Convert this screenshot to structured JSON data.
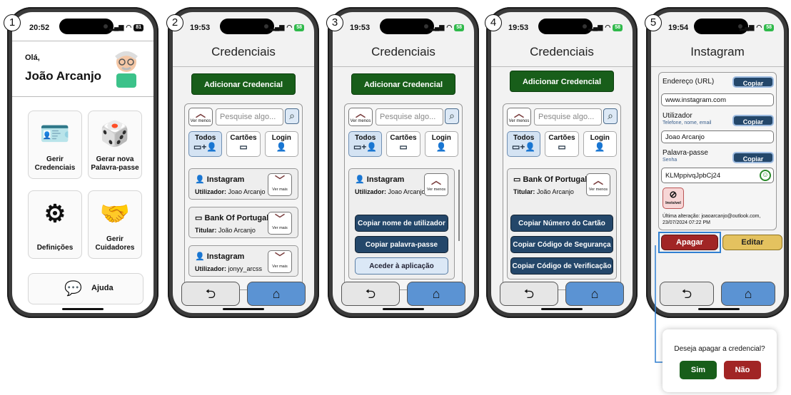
{
  "steps": [
    "1",
    "2",
    "3",
    "4",
    "5"
  ],
  "p1": {
    "time": "20:52",
    "battery": "81",
    "greeting": "Olá,",
    "name": "João Arcanjo",
    "tiles": [
      "Gerir Credenciais",
      "Gerar nova Palavra-passe",
      "Definições",
      "Gerir Cuidadores"
    ],
    "help": "Ajuda"
  },
  "p2": {
    "time": "19:53",
    "battery": "58",
    "title": "Credenciais",
    "add": "Adicionar Credencial",
    "ver_menos": "Ver menos",
    "search_placeholder": "Pesquise algo...",
    "tabs": [
      "Todos",
      "Cartões",
      "Login"
    ],
    "ver_mais": "Ver mais",
    "cards": [
      {
        "name": "Instagram",
        "label": "Utilizador:",
        "value": "Joao Arcanjo"
      },
      {
        "name": "Bank Of Portugal",
        "label": "Titular:",
        "value": "João Arcanjo"
      },
      {
        "name": "Instagram",
        "label": "Utilizador:",
        "value": "jonyy_arcss"
      }
    ]
  },
  "p3": {
    "time": "19:53",
    "battery": "58",
    "card_name": "Instagram",
    "card_label": "Utilizador:",
    "card_value": "Joao Arcanjo",
    "ver_menos": "Ver menos",
    "actions": [
      "Copiar nome de utilizador",
      "Copiar palavra-passe",
      "Aceder à aplicação"
    ]
  },
  "p4": {
    "time": "19:53",
    "battery": "58",
    "card_name": "Bank Of Portugal",
    "card_label": "Titular:",
    "card_value": "João Arcanjo",
    "ver_menos": "Ver menos",
    "actions": [
      "Copiar Número do Cartão",
      "Copiar Código de Segurança",
      "Copiar Código de Verificação"
    ]
  },
  "p5": {
    "time": "19:54",
    "battery": "58",
    "title": "Instagram",
    "url_label": "Endereço (URL)",
    "url_value": "www.instagram.com",
    "user_label": "Utilizador",
    "user_sub": "Telefone, nome, email",
    "user_value": "Joao Arcanjo",
    "pass_label": "Palavra-passe",
    "pass_sub": "Senha",
    "pass_value": "KLMppivqJpbCj24",
    "copy": "Copiar",
    "invisivel": "Invisível",
    "last_change": "Última alteração: joaoarcanjo@outlook.com, 23/07/2024 07:22 PM",
    "delete": "Apagar",
    "edit": "Editar"
  },
  "dialog": {
    "question": "Deseja apagar a credencial?",
    "yes": "Sim",
    "no": "Não"
  }
}
